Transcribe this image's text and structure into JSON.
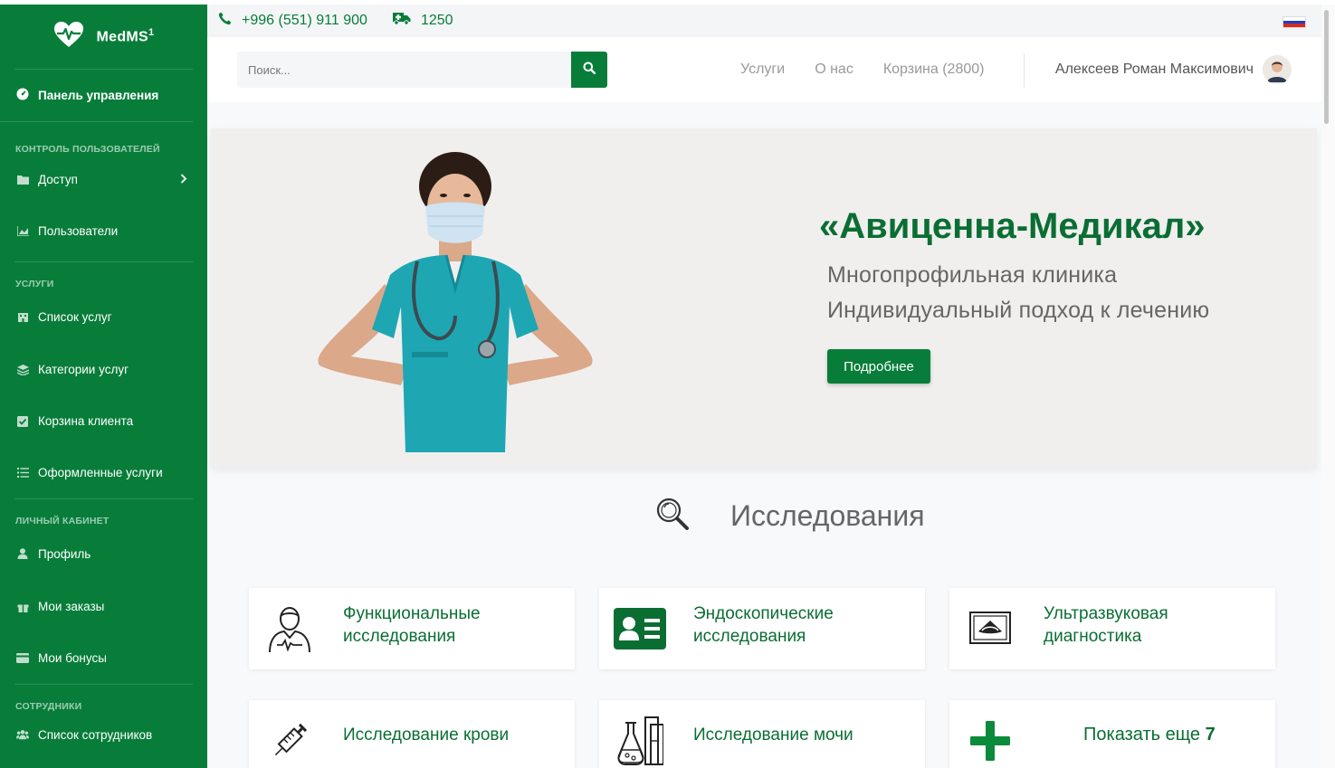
{
  "brand": {
    "name": "MedMS",
    "sup": "1"
  },
  "sidebar": {
    "dashboard": "Панель управления",
    "sections": [
      {
        "title": "Контроль пользователей",
        "items": [
          "Доступ",
          "Пользователи"
        ]
      },
      {
        "title": "Услуги",
        "items": [
          "Список услуг",
          "Категории услуг",
          "Корзина клиента",
          "Оформленные услуги"
        ]
      },
      {
        "title": "Личный кабинет",
        "items": [
          "Профиль",
          "Мои заказы",
          "Мои бонусы"
        ]
      },
      {
        "title": "Сотрудники",
        "items": [
          "Список сотрудников"
        ]
      }
    ]
  },
  "topbar": {
    "phone": "+996 (551) 911 900",
    "ambulance": "1250"
  },
  "header": {
    "search_placeholder": "Поиск...",
    "nav": [
      "Услуги",
      "О нас",
      "Корзина (2800)"
    ],
    "user_name": "Алексеев Роман Максимович"
  },
  "hero": {
    "title": "«Авиценна-Медикал»",
    "subtitle1": "Многопрофильная клиника",
    "subtitle2": "Индивидуальный подход к лечению",
    "button": "Подробнее"
  },
  "research": {
    "title": "Исследования",
    "cards": [
      {
        "line1": "Функциональные",
        "line2": "исследования"
      },
      {
        "line1": "Эндоскопические",
        "line2": "исследования"
      },
      {
        "line1": "Ультразвуковая",
        "line2": "диагностика"
      },
      {
        "line1": "Исследование крови"
      },
      {
        "line1": "Исследование мочи"
      }
    ],
    "more_label": "Показать еще",
    "more_count": "7"
  },
  "colors": {
    "brand": "#087d3a",
    "brand_dark": "#0a6e33"
  }
}
